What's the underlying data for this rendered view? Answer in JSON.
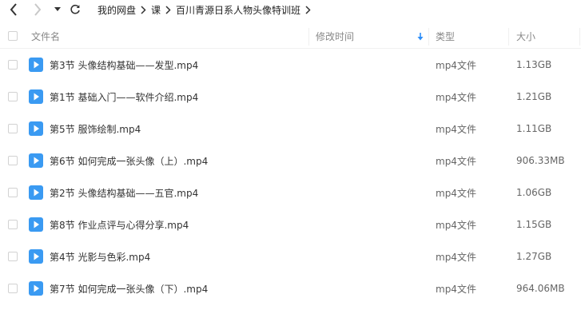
{
  "nav": {
    "back_icon": "chevron-left-icon",
    "forward_icon": "chevron-right-icon",
    "history_icon": "caret-down-icon",
    "refresh_icon": "refresh-icon"
  },
  "breadcrumb": {
    "items": [
      {
        "label": "我的网盘"
      },
      {
        "label": "课"
      },
      {
        "label": "百川青源日系人物头像特训班"
      }
    ],
    "separator_icon": "chevron-right-icon"
  },
  "header": {
    "name": "文件名",
    "modified": "修改时间",
    "sort_icon": "sort-down-arrow-icon",
    "type": "类型",
    "size": "大小"
  },
  "colors": {
    "accent": "#2c8ef8",
    "file_icon": "#3a9af2"
  },
  "files": [
    {
      "name": "第3节  头像结构基础——发型.mp4",
      "type": "mp4文件",
      "size": "1.13GB"
    },
    {
      "name": "第1节  基础入门——软件介绍.mp4",
      "type": "mp4文件",
      "size": "1.21GB"
    },
    {
      "name": "第5节  服饰绘制.mp4",
      "type": "mp4文件",
      "size": "1.11GB"
    },
    {
      "name": "第6节  如何完成一张头像（上）.mp4",
      "type": "mp4文件",
      "size": "906.33MB"
    },
    {
      "name": "第2节  头像结构基础——五官.mp4",
      "type": "mp4文件",
      "size": "1.06GB"
    },
    {
      "name": "第8节  作业点评与心得分享.mp4",
      "type": "mp4文件",
      "size": "1.15GB"
    },
    {
      "name": "第4节  光影与色彩.mp4",
      "type": "mp4文件",
      "size": "1.27GB"
    },
    {
      "name": "第7节  如何完成一张头像（下）.mp4",
      "type": "mp4文件",
      "size": "964.06MB"
    }
  ]
}
